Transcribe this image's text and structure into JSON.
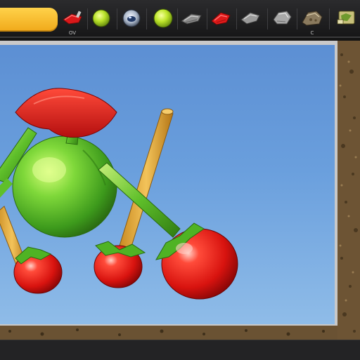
{
  "toolbar": {
    "main_tab_label": "",
    "tools": [
      {
        "icon": "red-brush-icon",
        "caption": "OV"
      },
      {
        "icon": "green-ball-icon",
        "caption": ""
      },
      {
        "icon": "camera-lens-icon",
        "caption": ""
      },
      {
        "icon": "green-ball-icon",
        "caption": ""
      },
      {
        "icon": "gray-brush-icon",
        "caption": ""
      },
      {
        "icon": "red-brush-icon",
        "caption": ""
      },
      {
        "icon": "gray-brush-icon",
        "caption": ""
      },
      {
        "icon": "stone-tool-icon",
        "caption": ""
      },
      {
        "icon": "terrain-tool-icon",
        "caption": "C"
      },
      {
        "icon": "layers-icon",
        "caption": ""
      }
    ]
  },
  "viewport": {
    "scene": "3d-fruit-model",
    "objects": [
      "apple",
      "leaf-cap",
      "wooden-stick",
      "cherry-tomato"
    ]
  },
  "colors": {
    "accent": "#f5b52a",
    "sky_top": "#5c8fd3",
    "sky_bottom": "#8fbce8",
    "apple_green": "#55c23a",
    "tomato_red": "#e01a1a",
    "terrain": "#6d5434"
  }
}
